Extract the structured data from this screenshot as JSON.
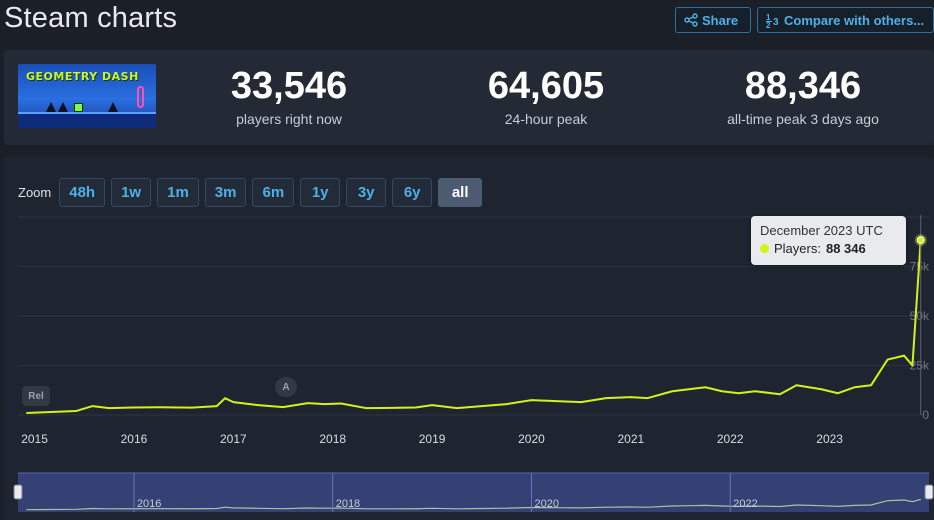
{
  "header": {
    "title": "Steam charts",
    "share_label": "Share",
    "compare_label": "Compare with others..."
  },
  "game": {
    "logo_text": "GEOMETRY DASH"
  },
  "stats": {
    "players_now": "33,546",
    "players_now_label": "players right now",
    "peak_24h": "64,605",
    "peak_24h_label": "24-hour peak",
    "all_time_peak": "88,346",
    "all_time_peak_label": "all-time peak 3 days ago"
  },
  "zoom": {
    "label": "Zoom",
    "options": [
      "48h",
      "1w",
      "1m",
      "3m",
      "6m",
      "1y",
      "3y",
      "6y",
      "all"
    ],
    "active": "all"
  },
  "tooltip": {
    "date": "December 2023 UTC",
    "series_label": "Players:",
    "value": "88 346"
  },
  "flags": {
    "release": "Rel",
    "annotation": "A"
  },
  "colors": {
    "line": "#d2f21a",
    "accent": "#4fb0e8",
    "background": "#1b2028",
    "navigator_bg": "#3a4580"
  },
  "chart_data": {
    "type": "line",
    "series": [
      {
        "name": "Players",
        "x": [
          "2014-12",
          "2015-03",
          "2015-06",
          "2015-08",
          "2015-10",
          "2016-01",
          "2016-04",
          "2016-08",
          "2016-11",
          "2016-12",
          "2017-01",
          "2017-04",
          "2017-07",
          "2017-10",
          "2017-12",
          "2018-02",
          "2018-05",
          "2018-08",
          "2018-11",
          "2019-01",
          "2019-04",
          "2019-07",
          "2019-10",
          "2020-01",
          "2020-04",
          "2020-07",
          "2020-10",
          "2021-01",
          "2021-03",
          "2021-06",
          "2021-08",
          "2021-10",
          "2021-12",
          "2022-02",
          "2022-04",
          "2022-07",
          "2022-09",
          "2022-12",
          "2023-02",
          "2023-04",
          "2023-06",
          "2023-08",
          "2023-10",
          "2023-11",
          "2023-12"
        ],
        "y": [
          1000,
          1500,
          2000,
          4500,
          3500,
          3800,
          3900,
          3700,
          4500,
          8500,
          6500,
          5000,
          4000,
          6000,
          5500,
          5800,
          3500,
          3600,
          3800,
          5000,
          3500,
          4500,
          5500,
          7500,
          7000,
          6500,
          8500,
          9000,
          8500,
          12000,
          13000,
          14000,
          12000,
          11000,
          12000,
          10500,
          15000,
          13000,
          11000,
          14000,
          15000,
          28000,
          30000,
          25000,
          88346
        ]
      }
    ],
    "x_ticks": [
      "2015",
      "2016",
      "2017",
      "2018",
      "2019",
      "2020",
      "2021",
      "2022",
      "2023"
    ],
    "y_ticks": [
      "0",
      "25k",
      "50k",
      "75k"
    ],
    "ylim": [
      0,
      100000
    ],
    "navigator_ticks": [
      "2016",
      "2018",
      "2020",
      "2022"
    ],
    "grid": true,
    "legend": "none"
  }
}
